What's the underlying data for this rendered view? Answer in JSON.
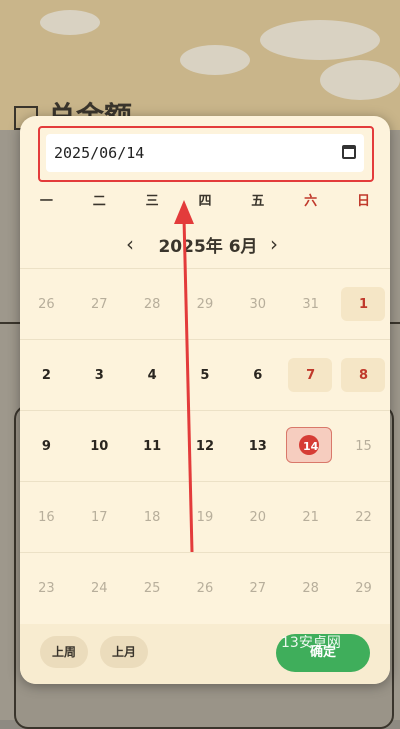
{
  "background": {
    "title": "总金额"
  },
  "date_input": {
    "value": "2025/06/14",
    "icon": "calendar-icon"
  },
  "weekdays": [
    "一",
    "二",
    "三",
    "四",
    "五",
    "六",
    "日"
  ],
  "month_nav": {
    "label": "2025年 6月",
    "prev": "‹",
    "next": "›"
  },
  "weeks": [
    [
      "26",
      "27",
      "28",
      "29",
      "30",
      "31",
      "1"
    ],
    [
      "2",
      "3",
      "4",
      "5",
      "6",
      "7",
      "8"
    ],
    [
      "9",
      "10",
      "11",
      "12",
      "13",
      "14",
      "15"
    ],
    [
      "16",
      "17",
      "18",
      "19",
      "20",
      "21",
      "22"
    ],
    [
      "23",
      "24",
      "25",
      "26",
      "27",
      "28",
      "29"
    ]
  ],
  "selected_day": "14",
  "footer": {
    "prev_week": "上周",
    "prev_month": "上月",
    "confirm": "确定"
  },
  "watermark": "13安卓网",
  "colors": {
    "accent_red": "#d63c35",
    "confirm_green": "#3fae5b",
    "popup_bg": "#fdf3dc"
  }
}
